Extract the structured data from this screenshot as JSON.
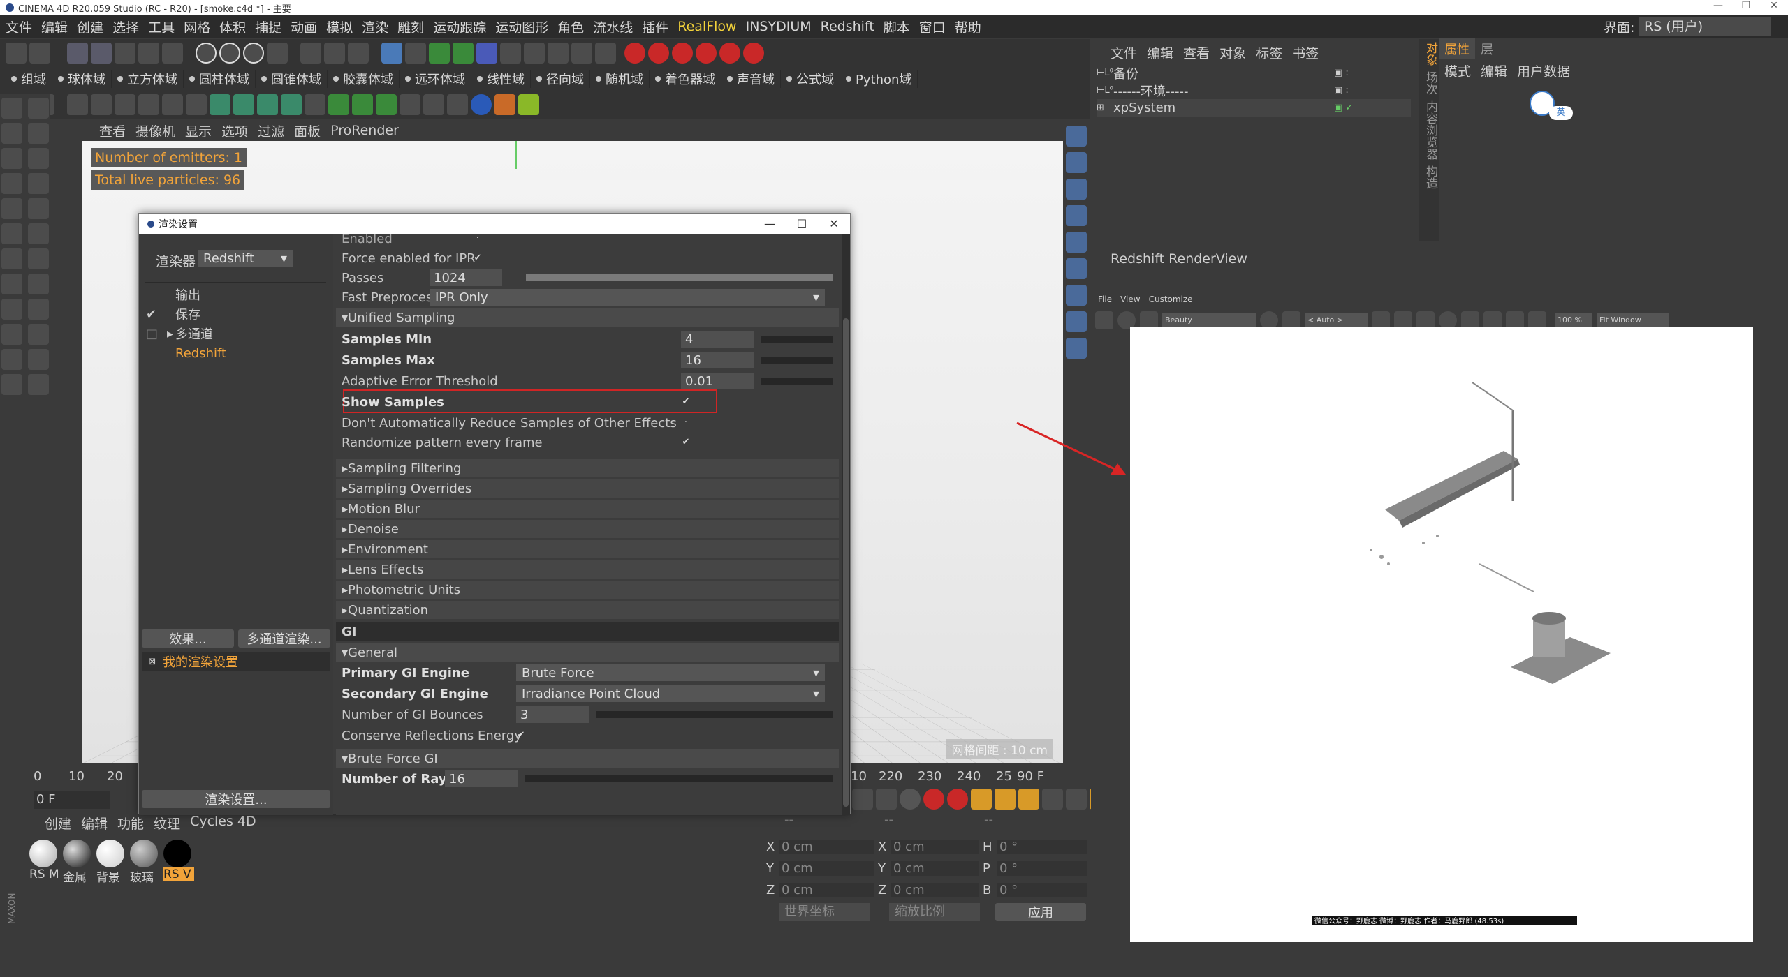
{
  "window": {
    "title": "CINEMA 4D R20.059 Studio (RC - R20) - [smoke.c4d *] - 主要",
    "controls": [
      "—",
      "❐",
      "✕"
    ]
  },
  "menubar": {
    "items": [
      "文件",
      "编辑",
      "创建",
      "选择",
      "工具",
      "网格",
      "体积",
      "捕捉",
      "动画",
      "模拟",
      "渲染",
      "雕刻",
      "运动跟踪",
      "运动图形",
      "角色",
      "流水线",
      "插件",
      "RealFlow",
      "INSYDIUM",
      "Redshift",
      "脚本",
      "窗口",
      "帮助"
    ],
    "highlight_index": 17,
    "interface_label": "界面:",
    "interface_value": "RS (用户)"
  },
  "fields_toolbar": [
    "组域",
    "球体域",
    "立方体域",
    "圆柱体域",
    "圆锥体域",
    "胶囊体域",
    "远环体域",
    "线性域",
    "径向域",
    "随机域",
    "着色器域",
    "声音域",
    "公式域",
    "Python域"
  ],
  "viewport": {
    "menu": [
      "查看",
      "摄像机",
      "显示",
      "选项",
      "过滤",
      "面板",
      "ProRender"
    ],
    "overlay_emitters": "Number of emitters: 1",
    "overlay_particles": "Total live particles: 96",
    "grid_distance": "网格间距 : 10 cm"
  },
  "timeline": {
    "ticks": [
      "0",
      "10",
      "20"
    ],
    "ticks_right": [
      "10",
      "220",
      "230",
      "240",
      "25",
      "90 F"
    ],
    "current_frame": "0 F"
  },
  "materials": {
    "menu": [
      "创建",
      "编辑",
      "功能",
      "纹理",
      "Cycles 4D"
    ],
    "items": [
      "RS M",
      "金属",
      "背景",
      "玻璃",
      "RS V"
    ],
    "selected_index": 4
  },
  "coords": {
    "header": [
      "--",
      "--",
      "--"
    ],
    "rows": [
      {
        "a": "X",
        "av": "0 cm",
        "b": "X",
        "bv": "0 cm",
        "c": "H",
        "cv": "0 °"
      },
      {
        "a": "Y",
        "av": "0 cm",
        "b": "Y",
        "bv": "0 cm",
        "c": "P",
        "cv": "0 °"
      },
      {
        "a": "Z",
        "av": "0 cm",
        "b": "Z",
        "bv": "0 cm",
        "c": "B",
        "cv": "0 °"
      }
    ],
    "world_coords": "世界坐标",
    "scale": "缩放比例",
    "apply": "应用"
  },
  "dialog": {
    "title": "渲染设置",
    "renderer_label": "渲染器",
    "renderer_value": "Redshift",
    "tree": [
      {
        "label": "输出",
        "check": ""
      },
      {
        "label": "保存",
        "check": "✔"
      },
      {
        "label": "多通道",
        "check": "□"
      },
      {
        "label": "Redshift",
        "check": ""
      }
    ],
    "effects_btn": "效果...",
    "multipass_btn": "多通道渲染...",
    "preset_name": "我的渲染设置",
    "render_settings_btn": "渲染设置...",
    "params": {
      "enabled": "Enabled",
      "force_ipr": "Force enabled for IPR",
      "passes_label": "Passes",
      "passes_value": "1024",
      "fast_pre_label": "Fast Preprocessing",
      "fast_pre_value": "IPR Only",
      "unified_sampling": "Unified Sampling",
      "samples_min_label": "Samples Min",
      "samples_min_value": "4",
      "samples_max_label": "Samples Max",
      "samples_max_value": "16",
      "adaptive_label": "Adaptive Error Threshold",
      "adaptive_value": "0.01",
      "show_samples": "Show Samples",
      "dont_reduce": "Don't Automatically Reduce Samples of Other Effects",
      "randomize": "Randomize pattern every frame"
    },
    "sections": [
      "Sampling Filtering",
      "Sampling Overrides",
      "Motion Blur",
      "Denoise",
      "Environment",
      "Lens Effects",
      "Photometric Units",
      "Quantization"
    ],
    "gi": {
      "header": "GI",
      "general": "General",
      "primary_label": "Primary GI Engine",
      "primary_value": "Brute Force",
      "secondary_label": "Secondary GI Engine",
      "secondary_value": "Irradiance Point Cloud",
      "bounces_label": "Number of GI Bounces",
      "bounces_value": "3",
      "conserve": "Conserve Reflections Energy",
      "brute_force": "Brute Force GI",
      "rays_label": "Number of Rays",
      "rays_value": "16"
    }
  },
  "object_manager": {
    "menu": [
      "文件",
      "编辑",
      "查看",
      "对象",
      "标签",
      "书签"
    ],
    "objects": [
      "备份",
      "------环境-----",
      "xpSystem"
    ]
  },
  "attributes": {
    "tabs": [
      "属性",
      "层"
    ],
    "menu": [
      "模式",
      "编辑",
      "用户数据"
    ],
    "badge": "英"
  },
  "side_tabs": [
    "对象",
    "场次",
    "内容浏览器",
    "构造"
  ],
  "rs_view": {
    "title": "Redshift RenderView",
    "menu": [
      "File",
      "View",
      "Customize"
    ],
    "aov": "Beauty",
    "auto": "< Auto >",
    "zoom": "100 %",
    "fit": "Fit Window",
    "footer_text": "微信公众号：野鹿志  微博：野鹿志  作者：马鹿野郎  (48.53s)"
  }
}
